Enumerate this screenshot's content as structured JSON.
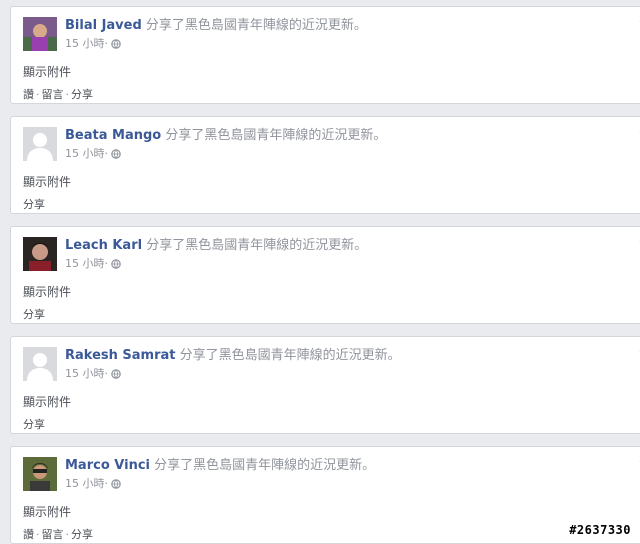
{
  "posts": [
    {
      "name": "Bilal Javed",
      "action": "分享了黑色島國青年陣線的近況更新。",
      "time": "15 小時",
      "attachment": "顯示附件",
      "actions": [
        "讚",
        "留言",
        "分享"
      ],
      "avatar": "photo-purple"
    },
    {
      "name": "Beata Mango",
      "action": "分享了黑色島國青年陣線的近況更新。",
      "time": "15 小時",
      "attachment": "顯示附件",
      "actions": [
        "分享"
      ],
      "avatar": "default-silhouette"
    },
    {
      "name": "Leach Karl",
      "action": "分享了黑色島國青年陣線的近況更新。",
      "time": "15 小時",
      "attachment": "顯示附件",
      "actions": [
        "分享"
      ],
      "avatar": "photo-dark"
    },
    {
      "name": "Rakesh Samrat",
      "action": "分享了黑色島國青年陣線的近況更新。",
      "time": "15 小時",
      "attachment": "顯示附件",
      "actions": [
        "分享"
      ],
      "avatar": "default-silhouette"
    },
    {
      "name": "Marco Vinci",
      "action": "分享了黑色島國青年陣線的近況更新。",
      "time": "15 小時",
      "attachment": "顯示附件",
      "actions": [
        "讚",
        "留言",
        "分享"
      ],
      "avatar": "photo-green"
    }
  ],
  "separator": "·",
  "watermark": "#2637330",
  "colors": {
    "name": "#3b5998",
    "secondary": "#90949c",
    "body_text": "#4b4f56",
    "card_border": "#d3d6db",
    "page_bg": "#e9ebee"
  }
}
